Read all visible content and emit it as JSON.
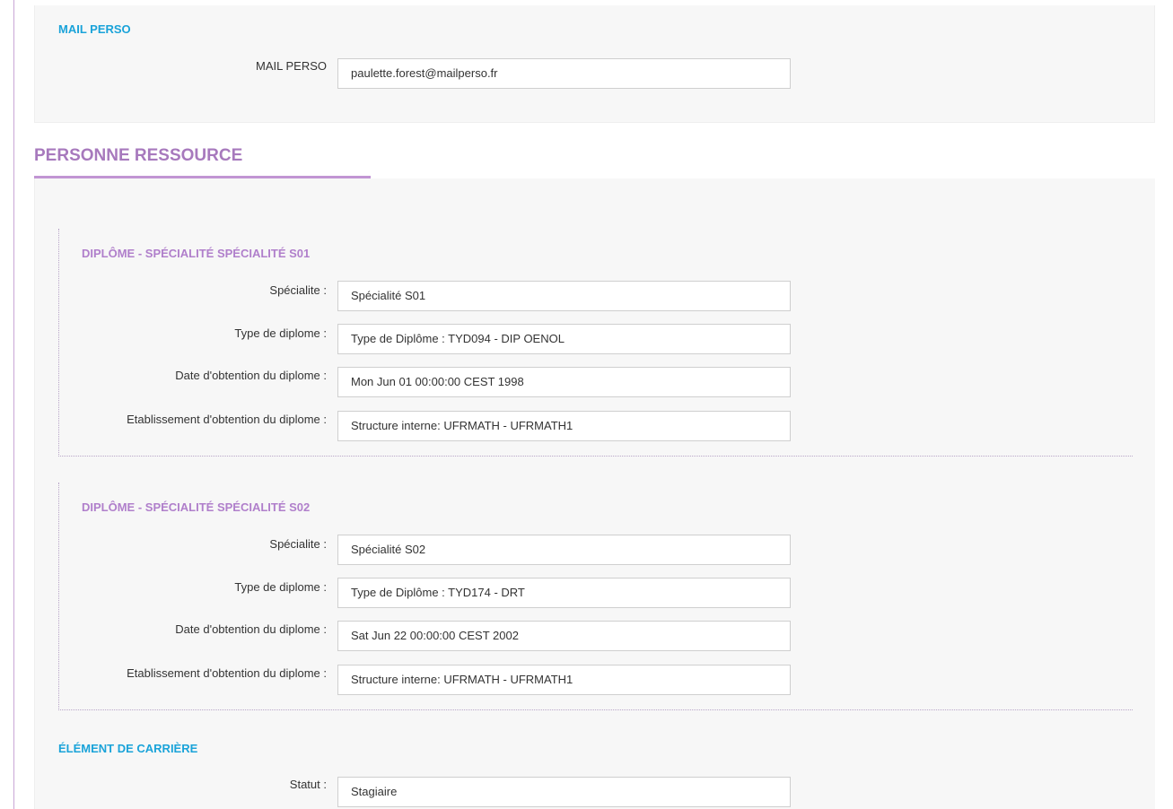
{
  "mail_perso": {
    "section_title": "MAIL PERSO",
    "label": "MAIL PERSO",
    "value": "paulette.forest@mailperso.fr"
  },
  "personne_ressource": {
    "heading": "PERSONNE RESSOURCE",
    "diplomes": [
      {
        "title": "DIPLÔME - SPÉCIALITÉ SPÉCIALITÉ S01",
        "fields": [
          {
            "label": "Spécialite :",
            "value": "Spécialité S01"
          },
          {
            "label": "Type de diplome :",
            "value": "Type de Diplôme : TYD094 - DIP OENOL"
          },
          {
            "label": "Date d'obtention du diplome :",
            "value": "Mon Jun 01 00:00:00 CEST 1998"
          },
          {
            "label": "Etablissement d'obtention du diplome :",
            "value": "Structure interne: UFRMATH - UFRMATH1"
          }
        ]
      },
      {
        "title": "DIPLÔME - SPÉCIALITÉ SPÉCIALITÉ S02",
        "fields": [
          {
            "label": "Spécialite :",
            "value": "Spécialité S02"
          },
          {
            "label": "Type de diplome :",
            "value": "Type de Diplôme : TYD174 - DRT"
          },
          {
            "label": "Date d'obtention du diplome :",
            "value": "Sat Jun 22 00:00:00 CEST 2002"
          },
          {
            "label": "Etablissement d'obtention du diplome :",
            "value": "Structure interne: UFRMATH - UFRMATH1"
          }
        ]
      }
    ],
    "element_carriere": {
      "section_title": "ÉLÉMENT DE CARRIÈRE",
      "fields": [
        {
          "label": "Statut :",
          "value": "Stagiaire"
        }
      ]
    }
  },
  "colors": {
    "accent_purple": "#a779bd",
    "accent_blue": "#1aa3d9",
    "panel_bg": "#f7f7f7"
  }
}
